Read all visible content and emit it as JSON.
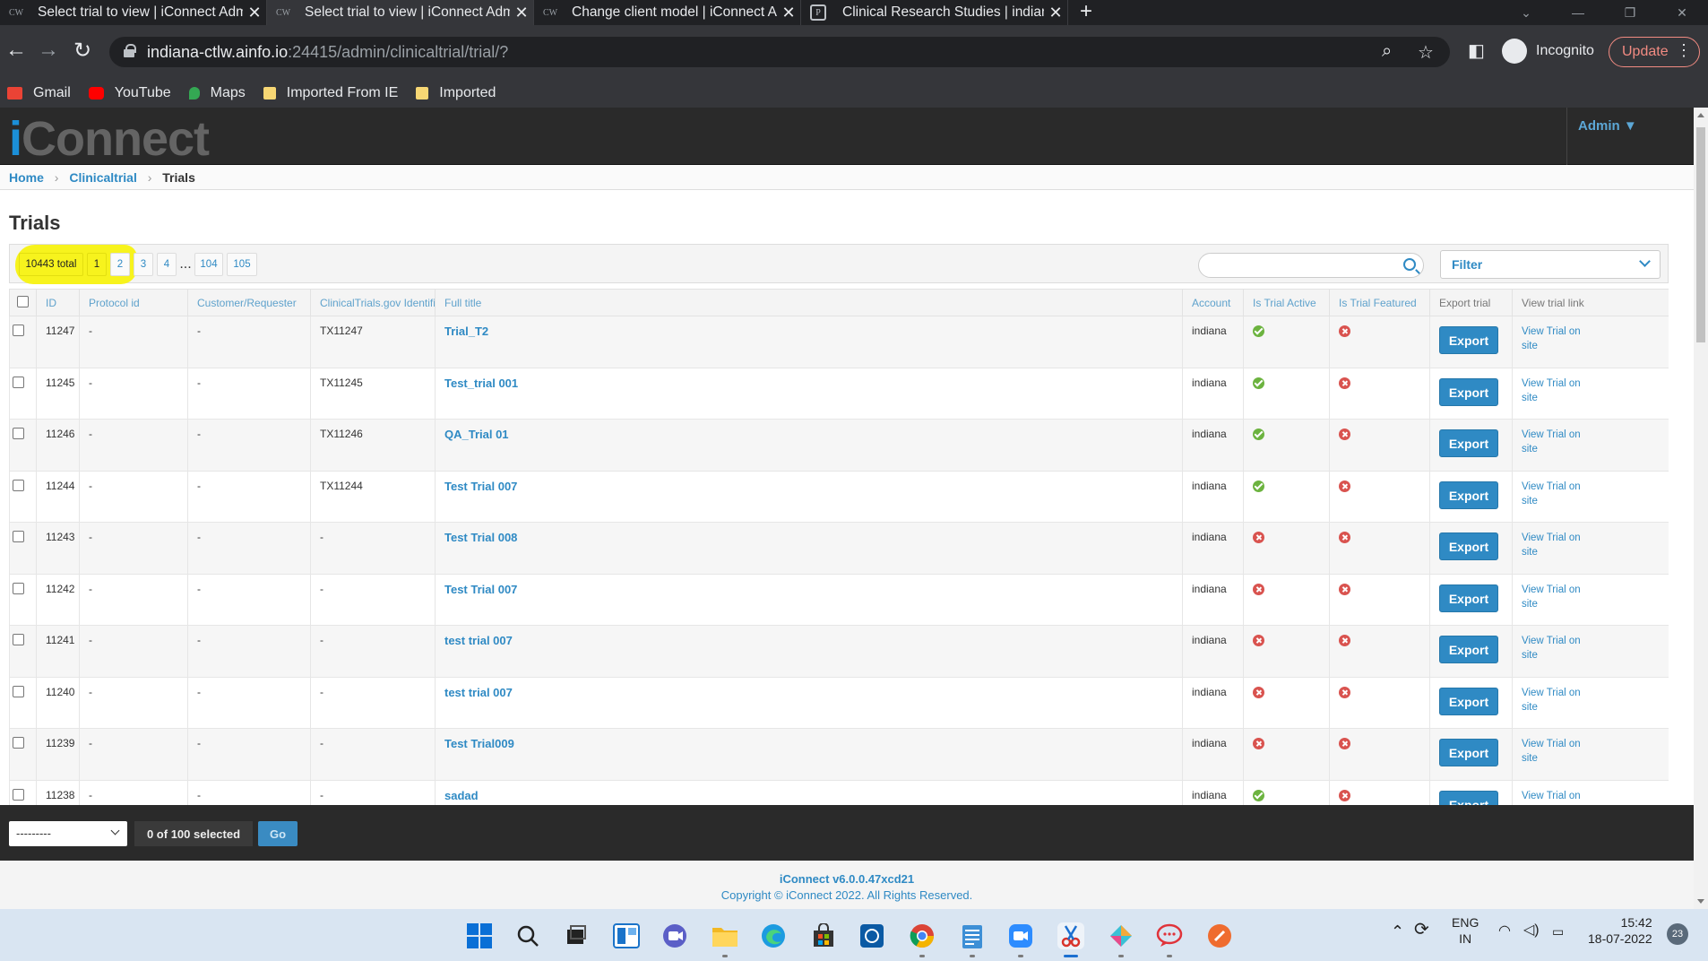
{
  "browser": {
    "tabs": [
      {
        "favicon": "CW",
        "title": "Select trial to view | iConnect Adm",
        "close": "✕"
      },
      {
        "favicon": "CW",
        "title": "Select trial to view | iConnect Adm",
        "close": "✕"
      },
      {
        "favicon": "CW",
        "title": "Change client model | iConnect A",
        "close": "✕"
      },
      {
        "favicon": "",
        "title": "Clinical Research Studies | indiana",
        "close": "✕"
      }
    ],
    "new_tab": "+",
    "url_host": "indiana-ctlw.ainfo.io",
    "url_rest": ":24415/admin/clinicaltrial/trial/?",
    "incognito_label": "Incognito",
    "update_label": "Update",
    "bookmarks": [
      {
        "label": "Gmail",
        "color": "#ea4335"
      },
      {
        "label": "YouTube",
        "color": "#ff0000"
      },
      {
        "label": "Maps",
        "color": "#34a853"
      },
      {
        "label": "Imported From IE",
        "color": "#f7d774"
      },
      {
        "label": "Imported",
        "color": "#f7d774"
      }
    ]
  },
  "header": {
    "logo_i": "i",
    "logo_rest": "Connect",
    "admin_menu": "Admin ▼"
  },
  "breadcrumbs": {
    "home": "Home",
    "app": "Clinicaltrial",
    "current": "Trials",
    "sep": "›"
  },
  "page_title": "Trials",
  "pagination": {
    "total": "10443 total",
    "pages": [
      "1",
      "2",
      "3",
      "4",
      "...",
      "104",
      "105"
    ]
  },
  "filter": {
    "label": "Filter"
  },
  "table": {
    "columns": [
      "ID",
      "Protocol id",
      "Customer/Requester",
      "ClinicalTrials.gov Identifier",
      "Full title",
      "Account",
      "Is Trial Active",
      "Is Trial Featured",
      "Export trial",
      "View trial link"
    ],
    "export_label": "Export",
    "view_label_1": "View Trial on",
    "view_label_2": "site",
    "rows": [
      {
        "id": "11247",
        "protocol": "-",
        "customer": "-",
        "ctgov": "TX11247",
        "title": "Trial_T2",
        "account": "indiana",
        "active": true,
        "featured": false
      },
      {
        "id": "11245",
        "protocol": "-",
        "customer": "-",
        "ctgov": "TX11245",
        "title": "Test_trial 001",
        "account": "indiana",
        "active": true,
        "featured": false
      },
      {
        "id": "11246",
        "protocol": "-",
        "customer": "-",
        "ctgov": "TX11246",
        "title": "QA_Trial 01",
        "account": "indiana",
        "active": true,
        "featured": false
      },
      {
        "id": "11244",
        "protocol": "-",
        "customer": "-",
        "ctgov": "TX11244",
        "title": "Test Trial 007",
        "account": "indiana",
        "active": true,
        "featured": false
      },
      {
        "id": "11243",
        "protocol": "-",
        "customer": "-",
        "ctgov": "-",
        "title": "Test Trial 008",
        "account": "indiana",
        "active": false,
        "featured": false
      },
      {
        "id": "11242",
        "protocol": "-",
        "customer": "-",
        "ctgov": "-",
        "title": "Test Trial 007",
        "account": "indiana",
        "active": false,
        "featured": false
      },
      {
        "id": "11241",
        "protocol": "-",
        "customer": "-",
        "ctgov": "-",
        "title": "test trial 007",
        "account": "indiana",
        "active": false,
        "featured": false
      },
      {
        "id": "11240",
        "protocol": "-",
        "customer": "-",
        "ctgov": "-",
        "title": "test trial 007",
        "account": "indiana",
        "active": false,
        "featured": false
      },
      {
        "id": "11239",
        "protocol": "-",
        "customer": "-",
        "ctgov": "-",
        "title": "Test Trial009",
        "account": "indiana",
        "active": false,
        "featured": false
      },
      {
        "id": "11238",
        "protocol": "-",
        "customer": "-",
        "ctgov": "-",
        "title": "sadad",
        "account": "indiana",
        "active": true,
        "featured": false
      }
    ]
  },
  "actions": {
    "select_value": "---------",
    "selected_count": "0 of 100 selected",
    "go_label": "Go"
  },
  "footer": {
    "version": "iConnect v6.0.0.47xcd21",
    "copyright": "Copyright © iConnect 2022. All Rights Reserved."
  },
  "taskbar": {
    "lang_1": "ENG",
    "lang_2": "IN",
    "time": "15:42",
    "date": "18-07-2022",
    "notification_count": "23"
  },
  "colors": {
    "accent": "#2f8ac4",
    "highlight": "#f7f31d",
    "header_bg": "#2a2a2a"
  }
}
